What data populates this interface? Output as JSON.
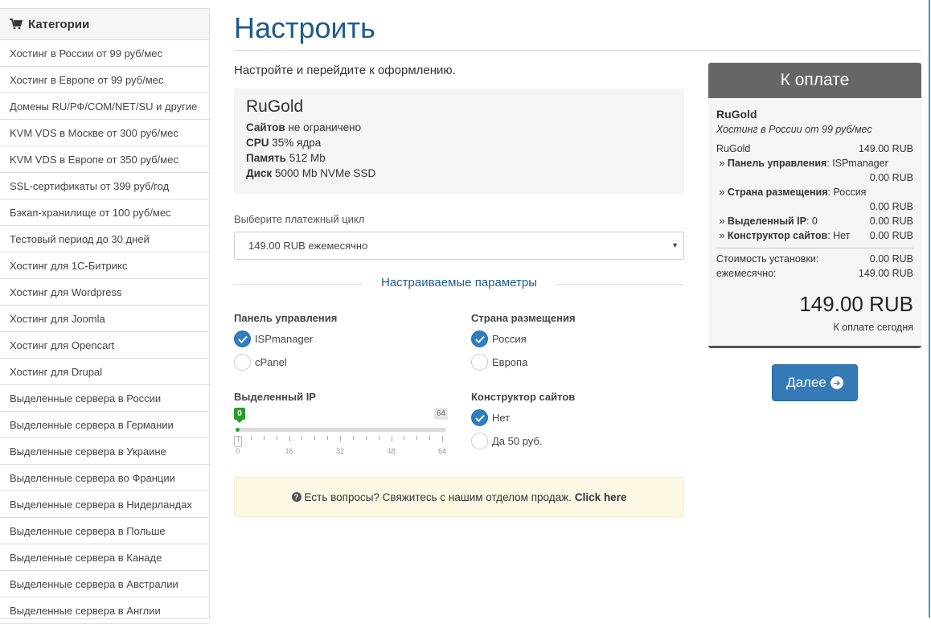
{
  "sidebar": {
    "title": "Категории",
    "items": [
      "Хостинг в России от 99 руб/мес",
      "Хостинг в Европе от 99 руб/мес",
      "Домены RU/РФ/COM/NET/SU и другие",
      "KVM VDS в Москве от 300 руб/мес",
      "KVM VDS в Европе от 350 руб/мес",
      "SSL-сертификаты от 399 руб/год",
      "Бэкап-хранилище от 100 руб/мес",
      "Тестовый период до 30 дней",
      "Хостинг для 1С-Битрикс",
      "Хостинг для Wordpress",
      "Хостинг для Joomla",
      "Хостинг для Opencart",
      "Хостинг для Drupal",
      "Выделенные сервера в России",
      "Выделенные сервера в Германии",
      "Выделенные сервера в Украине",
      "Выделенные сервера во Франции",
      "Выделенные сервера в Нидерландах",
      "Выделенные сервера в Польше",
      "Выделенные сервера в Канаде",
      "Выделенные сервера в Австралии",
      "Выделенные сервера в Англии"
    ]
  },
  "page": {
    "title": "Настроить",
    "intro": "Настройте и перейдите к оформлению."
  },
  "product": {
    "name": "RuGold",
    "specs": [
      {
        "label": "Сайтов",
        "value": "не ограничено"
      },
      {
        "label": "CPU",
        "value": "35% ядра"
      },
      {
        "label": "Память",
        "value": "512 Mb"
      },
      {
        "label": "Диск",
        "value": "5000 Mb NVMe SSD"
      }
    ]
  },
  "billing": {
    "label": "Выберите платежный цикл",
    "selected": "149.00 RUB ежемесячно"
  },
  "options": {
    "heading": "Настраиваемые параметры",
    "panel": {
      "label": "Панель управления",
      "choices": [
        "ISPmanager",
        "cPanel"
      ],
      "selected": 0
    },
    "country": {
      "label": "Страна размещения",
      "choices": [
        "Россия",
        "Европа"
      ],
      "selected": 0
    },
    "ip": {
      "label": "Выделенный IP",
      "value": "0",
      "max": "64",
      "ticks": [
        "0",
        "16",
        "32",
        "48",
        "64"
      ]
    },
    "builder": {
      "label": "Конструктор сайтов",
      "choices": [
        "Нет",
        "Да 50 руб."
      ],
      "selected": 0
    }
  },
  "alert": {
    "text": "Есть вопросы? Свяжитесь с нашим отделом продаж.",
    "link": "Click here"
  },
  "summary": {
    "title": "К оплате",
    "product": "RuGold",
    "group": "Хостинг в России от 99 руб/мес",
    "base_name": "RuGold",
    "base_price": "149.00 RUB",
    "panel_label": "Панель управления",
    "panel_value": "ISPmanager",
    "panel_price": "0.00 RUB",
    "country_label": "Страна размещения",
    "country_value": "Россия",
    "country_price": "0.00 RUB",
    "ip_label": "Выделенный IP",
    "ip_value": "0",
    "ip_price": "0.00 RUB",
    "builder_label": "Конструктор сайтов",
    "builder_value": "Нет",
    "builder_price": "0.00 RUB",
    "setup_label": "Стоимость установки:",
    "setup_price": "0.00 RUB",
    "monthly_label": "ежемесячно:",
    "monthly_price": "149.00 RUB",
    "total": "149.00 RUB",
    "total_label": "К оплате сегодня"
  },
  "next_label": "Далее",
  "colors": {
    "accent": "#337ab7",
    "title": "#1d5b8a",
    "slider": "#27a027",
    "summary_header": "#666666"
  }
}
